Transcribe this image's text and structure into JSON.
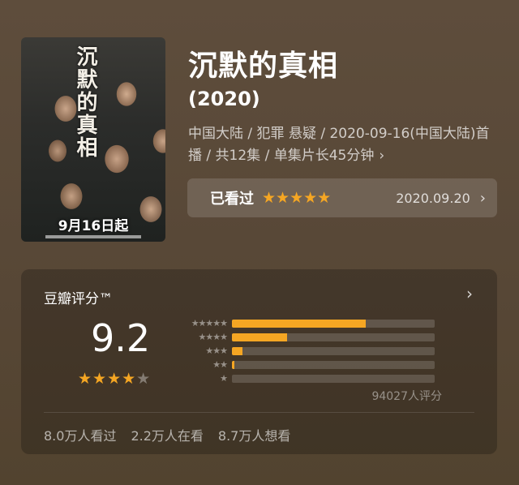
{
  "poster": {
    "title_text": "沉默的真相",
    "date_text": "9月16日起"
  },
  "show": {
    "title": "沉默的真相",
    "year": "(2020)",
    "meta": "中国大陆 / 犯罪 悬疑 / 2020-09-16(中国大陆)首播 / 共12集 / 单集片长45分钟",
    "meta_chevron": "›"
  },
  "watched": {
    "label": "已看过",
    "stars": "★★★★★",
    "date": "2020.09.20",
    "chevron": "›"
  },
  "rating": {
    "title": "豆瓣评分™",
    "chevron": "›",
    "score": "9.2",
    "stars_filled": "★★★★",
    "stars_half": "★",
    "total_count": "94027人评分",
    "distribution": [
      {
        "stars": "★★★★★",
        "fraction": 0.66
      },
      {
        "stars": "★★★★",
        "fraction": 0.27
      },
      {
        "stars": "★★★",
        "fraction": 0.05
      },
      {
        "stars": "★★",
        "fraction": 0.01
      },
      {
        "stars": "★",
        "fraction": 0.0
      }
    ]
  },
  "stats": {
    "watched": "8.0万人看过",
    "watching": "2.2万人在看",
    "want": "8.7万人想看"
  },
  "colors": {
    "accent_star": "#f5a623",
    "background": "#5a4a3a"
  }
}
